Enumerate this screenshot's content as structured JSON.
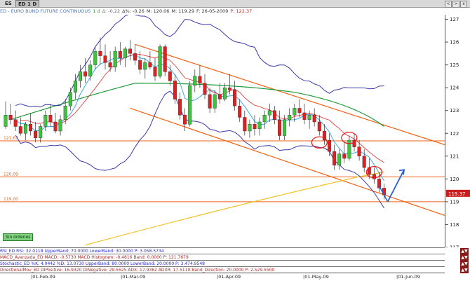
{
  "tabs": [
    {
      "label": "ES",
      "active": false
    },
    {
      "label": "ED 1 D",
      "active": true
    }
  ],
  "tab_controls": [
    "<",
    ">",
    "x"
  ],
  "info_bar": [
    {
      "text": "ED - EURO BUND FUTURE CONTINUOUS",
      "color": "#4a78c4"
    },
    {
      "text": "1 d",
      "color": "#2a9a2a"
    },
    {
      "text": "Δ: -0,22",
      "color": "#6a6a6a"
    },
    {
      "text": "Δ%: -0.26",
      "color": "#333333"
    },
    {
      "text": "M: 120.06",
      "color": "#333333"
    },
    {
      "text": "M: 119.29",
      "color": "#333333"
    },
    {
      "text": "F: 26-05-2009",
      "color": "#333333"
    },
    {
      "text": "P: 122.37",
      "color": "#d02020"
    }
  ],
  "chart_data": {
    "type": "candlestick",
    "title": "ED - EURO BUND FUTURE CONTINUOUS",
    "y_axis": {
      "ticks": [
        117,
        118,
        119,
        120,
        121,
        122,
        123,
        124,
        125,
        126,
        127
      ],
      "range": [
        117,
        127.2
      ],
      "grid": false
    },
    "x_axis": {
      "ticks": [
        "01-Feb-09",
        "01-Mar-09",
        "01-Apr-09",
        "01-May-09",
        "01-Jun-09"
      ]
    },
    "last_price": "119.37",
    "horizontal_levels": [
      {
        "label": "121,67",
        "value": 121.67
      },
      {
        "label": "120,09",
        "value": 120.09
      },
      {
        "label": "119,00",
        "value": 119.0
      }
    ],
    "candles": [
      [
        122.3,
        123.4,
        122.2,
        122.8
      ],
      [
        122.8,
        123.3,
        122.4,
        122.6
      ],
      [
        122.6,
        123.0,
        122.1,
        122.3
      ],
      [
        122.3,
        122.7,
        121.9,
        122.0
      ],
      [
        122.0,
        122.5,
        121.7,
        122.4
      ],
      [
        122.4,
        122.9,
        121.9,
        122.1
      ],
      [
        122.1,
        122.5,
        121.6,
        121.8
      ],
      [
        121.8,
        122.4,
        121.6,
        122.3
      ],
      [
        122.3,
        123.0,
        122.1,
        122.8
      ],
      [
        122.8,
        123.3,
        122.3,
        122.5
      ],
      [
        122.5,
        122.9,
        122.0,
        122.1
      ],
      [
        122.1,
        122.8,
        121.9,
        122.6
      ],
      [
        122.6,
        123.5,
        122.4,
        123.2
      ],
      [
        123.2,
        124.0,
        123.0,
        123.8
      ],
      [
        123.8,
        124.6,
        123.5,
        124.3
      ],
      [
        124.3,
        125.0,
        124.0,
        124.7
      ],
      [
        124.7,
        125.3,
        124.2,
        124.5
      ],
      [
        124.5,
        125.2,
        124.3,
        125.0
      ],
      [
        125.0,
        125.8,
        124.8,
        125.6
      ],
      [
        125.6,
        126.2,
        125.0,
        125.4
      ],
      [
        125.4,
        125.9,
        124.8,
        125.1
      ],
      [
        125.1,
        125.6,
        124.7,
        124.9
      ],
      [
        124.9,
        125.8,
        124.7,
        125.6
      ],
      [
        125.6,
        126.0,
        125.0,
        125.3
      ],
      [
        125.3,
        125.8,
        124.9,
        125.7
      ],
      [
        125.7,
        126.1,
        125.2,
        125.5
      ],
      [
        125.5,
        125.9,
        125.0,
        125.2
      ],
      [
        125.2,
        125.6,
        124.6,
        124.8
      ],
      [
        124.8,
        125.3,
        124.4,
        125.1
      ],
      [
        125.1,
        125.6,
        124.8,
        124.9
      ],
      [
        124.9,
        125.3,
        124.3,
        124.5
      ],
      [
        124.5,
        125.9,
        124.4,
        125.8
      ],
      [
        125.8,
        125.9,
        124.5,
        124.7
      ],
      [
        124.7,
        125.0,
        124.1,
        124.3
      ],
      [
        124.3,
        124.6,
        123.3,
        123.5
      ],
      [
        123.5,
        123.8,
        122.6,
        122.8
      ],
      [
        122.8,
        123.1,
        122.1,
        122.4
      ],
      [
        122.4,
        124.3,
        122.3,
        124.1
      ],
      [
        124.1,
        124.8,
        123.8,
        124.5
      ],
      [
        124.5,
        125.0,
        124.0,
        124.2
      ],
      [
        124.2,
        124.6,
        123.5,
        123.7
      ],
      [
        123.7,
        124.0,
        122.9,
        123.1
      ],
      [
        123.1,
        123.9,
        122.9,
        123.7
      ],
      [
        123.7,
        124.2,
        123.3,
        123.5
      ],
      [
        123.5,
        124.2,
        123.4,
        124.0
      ],
      [
        124.0,
        124.6,
        123.7,
        123.9
      ],
      [
        123.9,
        124.3,
        123.0,
        123.2
      ],
      [
        123.2,
        123.5,
        122.5,
        122.7
      ],
      [
        122.7,
        123.0,
        121.9,
        122.1
      ],
      [
        122.1,
        122.6,
        121.8,
        122.4
      ],
      [
        122.4,
        122.8,
        121.9,
        122.2
      ],
      [
        122.2,
        122.7,
        121.9,
        122.5
      ],
      [
        122.5,
        123.0,
        122.2,
        122.8
      ],
      [
        122.8,
        123.3,
        122.5,
        123.0
      ],
      [
        123.0,
        123.2,
        122.4,
        122.6
      ],
      [
        122.6,
        123.0,
        121.7,
        121.9
      ],
      [
        121.9,
        122.8,
        121.7,
        122.6
      ],
      [
        122.6,
        123.1,
        122.3,
        122.8
      ],
      [
        122.8,
        123.3,
        122.5,
        123.1
      ],
      [
        123.1,
        123.5,
        122.7,
        122.9
      ],
      [
        122.9,
        123.3,
        122.4,
        122.6
      ],
      [
        122.6,
        123.0,
        122.2,
        122.8
      ],
      [
        122.8,
        123.1,
        122.3,
        122.5
      ],
      [
        122.5,
        122.8,
        121.9,
        122.1
      ],
      [
        122.1,
        122.4,
        121.5,
        121.7
      ],
      [
        121.7,
        122.0,
        121.0,
        121.2
      ],
      [
        121.2,
        121.5,
        120.4,
        120.6
      ],
      [
        120.6,
        121.3,
        120.4,
        121.1
      ],
      [
        121.1,
        121.6,
        120.7,
        120.9
      ],
      [
        120.9,
        121.9,
        120.8,
        121.7
      ],
      [
        121.7,
        122.0,
        121.2,
        121.4
      ],
      [
        121.4,
        121.7,
        120.8,
        121.0
      ],
      [
        121.0,
        121.3,
        120.3,
        120.5
      ],
      [
        120.5,
        120.9,
        120.0,
        120.2
      ],
      [
        120.2,
        120.5,
        119.8,
        120.0
      ],
      [
        120.0,
        120.3,
        119.4,
        119.6
      ],
      [
        119.6,
        119.8,
        119.1,
        119.3
      ]
    ],
    "annotations": [
      {
        "type": "ellipse",
        "color": "#e02020",
        "near": "early May high ~121.6"
      },
      {
        "type": "ellipse",
        "color": "#e02020",
        "near": "mid May ~121.8"
      },
      {
        "type": "ellipse",
        "color": "#e02020",
        "near": "late May ~120.3"
      },
      {
        "type": "arrow",
        "color": "#2a5fd0",
        "direction": "up-right",
        "from": 119.0,
        "to": 120.4
      }
    ]
  },
  "indicator_rows": [
    {
      "name": "RSI",
      "text": "RSI_ED RSI: 32.0118  UpperBand: 70.0000  LowerBand: 30.0000  P: 3.058.5734",
      "color": "#2a2acc",
      "rsi": 32.0118
    },
    {
      "name": "MACD",
      "text": "MACD_Avanzada_ED MACD: -0.5730  MACD Histogram: -0.4816  Band: 0.0000  P: 121.7679",
      "color": "#b02a2a",
      "macd": -0.573
    },
    {
      "name": "Stochastic",
      "text": "Stochastic_ED %K: 4.0442  %D: 13.0730  UpperBand: 80.0000  LowerBand: 20.0000  P: 3.474.9548",
      "color": "#2a2acc",
      "k": 4.0442
    },
    {
      "name": "Directional",
      "text": "DirectionalMov_ED DIPositive: 16.9320  DINegative: 29.5625  ADX: 17.9362  ADXR: 17.5110  Band_Direction: 20.0000  P: 2.529.5500",
      "color": "#b02a2a",
      "adx": 17.9362
    }
  ],
  "badge": "Sin órdenes",
  "colors": {
    "bull": "#3cc43c",
    "bear": "#e02020",
    "outer_band": "#3a3aa8",
    "ma_green": "#1f9a3a",
    "ma_red": "#e04040",
    "ma_yellow": "#f0c020",
    "ma_cyan": "#40a8e0",
    "channel": "#f06010",
    "level": "#f06010",
    "last_price_bg": "#c81e1e"
  }
}
